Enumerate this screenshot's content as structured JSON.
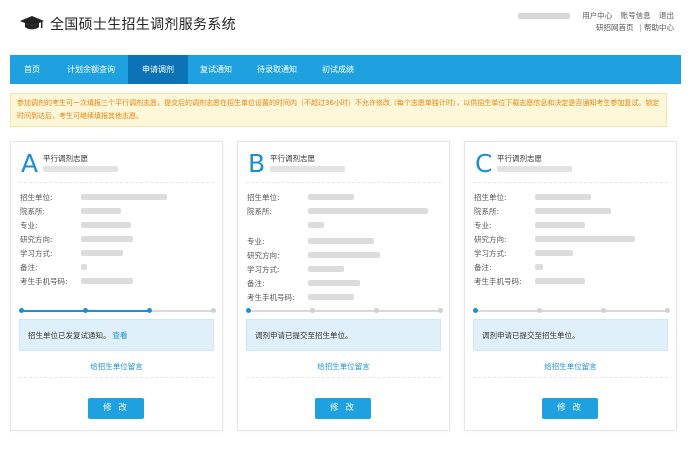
{
  "header": {
    "title": "全国硕士生招生调剂服务系统",
    "links_top": [
      "用户中心",
      "账号信息",
      "退出"
    ],
    "links_bottom": [
      "研招网首页",
      "帮助中心"
    ],
    "bottom_separator": "|"
  },
  "nav": {
    "items": [
      "首页",
      "计划余额查询",
      "申请调剂",
      "复试通知",
      "待录取通知",
      "初试成绩"
    ],
    "active": "申请调剂"
  },
  "notice": "参加调剂的考生可一次填报三个平行调剂志愿，提交后的调剂志愿在招生单位设置的时间内（不超过36小时）不允许修改（每个志愿单独计时），以供招生单位下载志愿信息和决定是否通知考生参加复试。锁定时间到达后，考生可继续填报其他志愿。",
  "cards": [
    {
      "letter": "A",
      "title": "平行调剂志愿",
      "labels": [
        "招生单位:",
        "院系所:",
        "专业:",
        "研究方向:",
        "学习方式:",
        "备注:",
        "考生手机号码:"
      ],
      "progress": 0.67,
      "status_text": "招生单位已发复试通知。",
      "status_link": "查看",
      "message_link": "给招生单位留言",
      "edit_label": "修 改"
    },
    {
      "letter": "B",
      "title": "平行调剂志愿",
      "labels": [
        "招生单位:",
        "院系所:",
        "专业:",
        "研究方向:",
        "学习方式:",
        "备注:",
        "考生手机号码:"
      ],
      "progress": 0.0,
      "status_text": "调剂申请已提交至招生单位。",
      "status_link": "",
      "message_link": "给招生单位留言",
      "edit_label": "修 改"
    },
    {
      "letter": "C",
      "title": "平行调剂志愿",
      "labels": [
        "招生单位:",
        "院系所:",
        "专业:",
        "研究方向:",
        "学习方式:",
        "备注:",
        "考生手机号码:"
      ],
      "progress": 0.0,
      "status_text": "调剂申请已提交至招生单位。",
      "status_link": "",
      "message_link": "给招生单位留言",
      "edit_label": "修 改"
    }
  ],
  "colors": {
    "accent": "#1fa0df",
    "nav_active": "#0c74b6",
    "notice_text": "#e6820e",
    "notice_bg": "#fdf7d9"
  }
}
